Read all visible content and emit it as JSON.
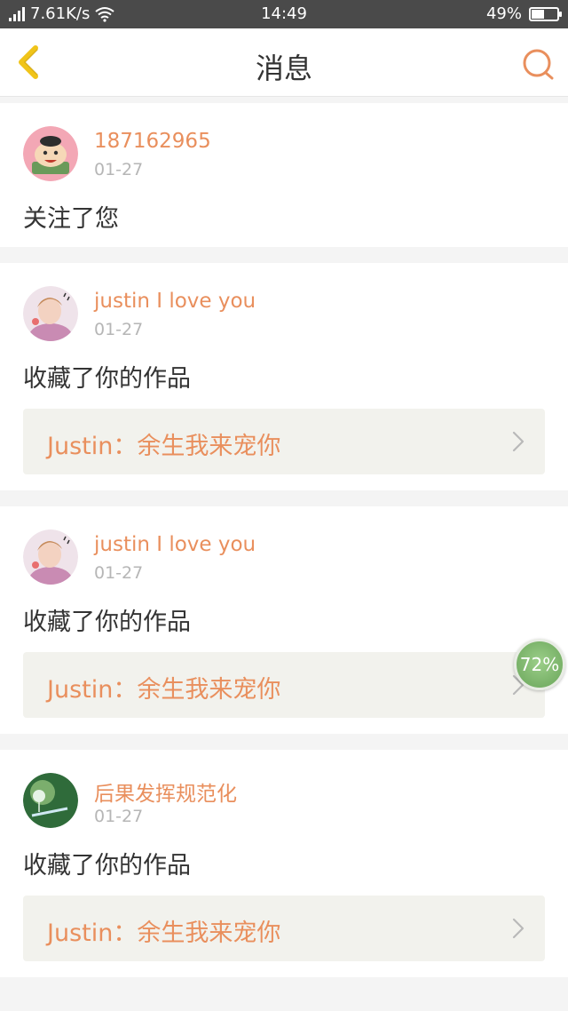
{
  "statusbar": {
    "network": "4G",
    "speed": "7.61K/s",
    "time": "14:49",
    "battery_text": "49%",
    "battery_level": 0.49
  },
  "header": {
    "title": "消息",
    "back_icon": "chevron-left-icon",
    "search_icon": "search-icon"
  },
  "colors": {
    "accent": "#e98f5d",
    "back_icon": "#f0c419",
    "text": "#333333",
    "muted": "#b6b6b6"
  },
  "notifications": [
    {
      "user": "187162965",
      "date": "01-27",
      "action": "关注了您"
    },
    {
      "user": "justin I love you",
      "date": "01-27",
      "action": "收藏了你的作品",
      "work": "Justin：余生我来宠你"
    },
    {
      "user": "justin I love you",
      "date": "01-27",
      "action": "收藏了你的作品",
      "work": "Justin：余生我来宠你"
    },
    {
      "user": "后果发挥规范化",
      "date": "01-27",
      "action": "收藏了你的作品",
      "work": "Justin：余生我来宠你"
    }
  ],
  "floating_badge": {
    "text": "72%"
  }
}
